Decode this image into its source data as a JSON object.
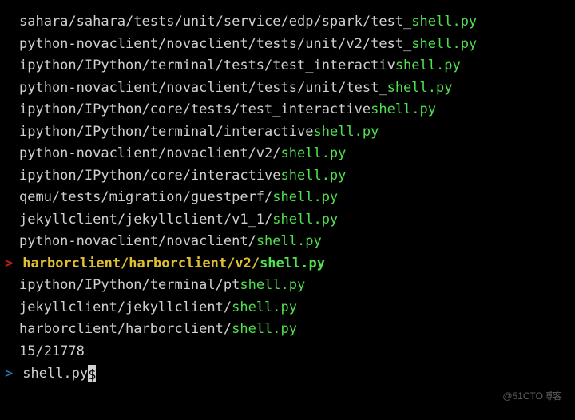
{
  "results": [
    {
      "prefix": "sahara/sahara/tests/unit/service/edp/spark/test_",
      "match": "shell.py"
    },
    {
      "prefix": "python-novaclient/novaclient/tests/unit/v2/test_",
      "match": "shell.py"
    },
    {
      "prefix": "ipython/IPython/terminal/tests/test_interactiv",
      "match": "shell.py",
      "no_e": true
    },
    {
      "prefix": "python-novaclient/novaclient/tests/unit/test_",
      "match": "shell.py"
    },
    {
      "prefix": "ipython/IPython/core/tests/test_interactive",
      "match": "shell.py"
    },
    {
      "prefix": "ipython/IPython/terminal/interactive",
      "match": "shell.py"
    },
    {
      "prefix": "python-novaclient/novaclient/v2/",
      "match": "shell.py"
    },
    {
      "prefix": "ipython/IPython/core/interactive",
      "match": "shell.py"
    },
    {
      "prefix": "qemu/tests/migration/guestperf/",
      "match": "shell.py"
    },
    {
      "prefix": "jekyllclient/jekyllclient/v1_1/",
      "match": "shell.py"
    },
    {
      "prefix": "python-novaclient/novaclient/",
      "match": "shell.py"
    }
  ],
  "selected": {
    "chevron": ">",
    "prefix": "harborclient/harborclient/v2/",
    "match": "shell.py"
  },
  "after": [
    {
      "prefix": "ipython/IPython/terminal/pt",
      "match": "shell.py"
    },
    {
      "prefix": "jekyllclient/jekyllclient/",
      "match": "shell.py"
    },
    {
      "prefix": "harborclient/harborclient/",
      "match": "shell.py"
    }
  ],
  "counter": "15/21778",
  "prompt": {
    "chevron": ">",
    "query": "shell.py",
    "cursor": "$"
  },
  "watermark": "@51CTO博客"
}
